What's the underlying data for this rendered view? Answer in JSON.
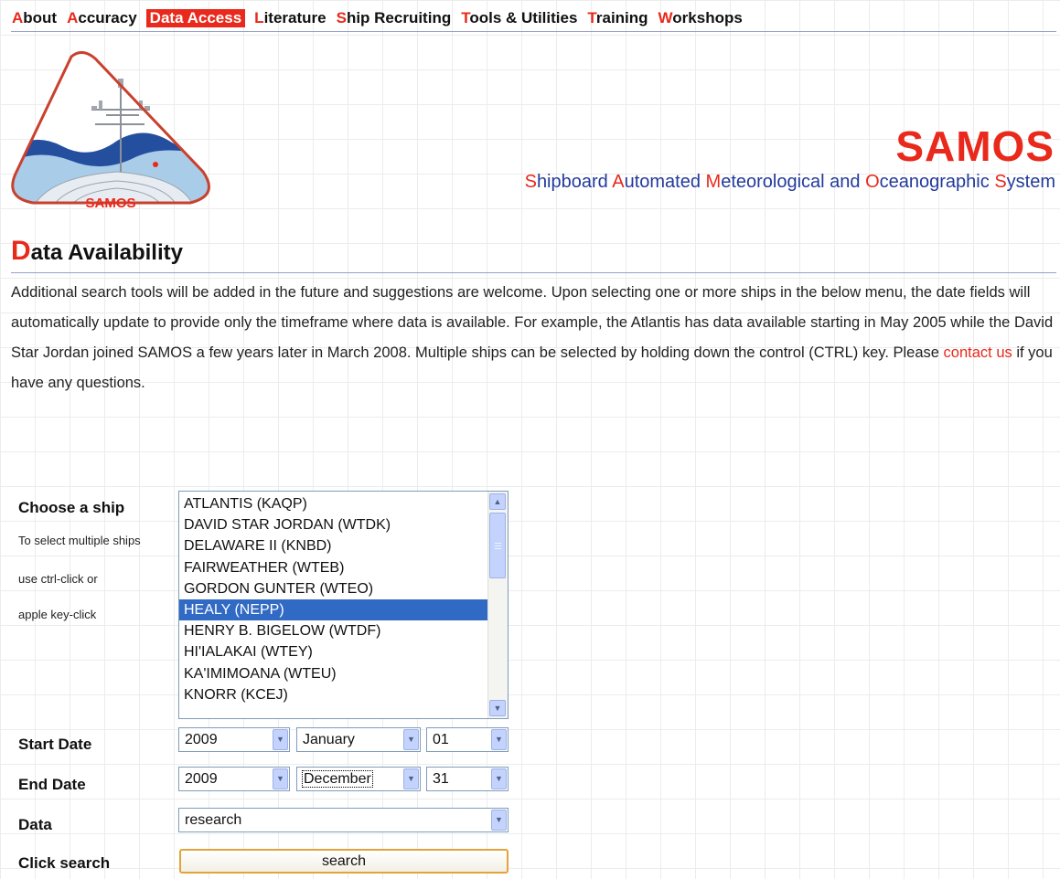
{
  "nav": {
    "items": [
      {
        "first": "A",
        "rest": "bout"
      },
      {
        "first": "A",
        "rest": "ccuracy"
      },
      {
        "first": "D",
        "rest": "ata Access"
      },
      {
        "first": "L",
        "rest": "iterature"
      },
      {
        "first": "S",
        "rest": "hip Recruiting"
      },
      {
        "first": "T",
        "rest": "ools & Utilities"
      },
      {
        "first": "T",
        "rest": "raining"
      },
      {
        "first": "W",
        "rest": "orkshops"
      }
    ],
    "active_index": 2
  },
  "logo": {
    "text": "SAMOS"
  },
  "brand": {
    "title": "SAMOS",
    "subtitle_parts": [
      {
        "cap": "S",
        "rest": "hipboard "
      },
      {
        "cap": "A",
        "rest": "utomated "
      },
      {
        "cap": "M",
        "rest": "eteorological and "
      },
      {
        "cap": "O",
        "rest": "ceanographic "
      },
      {
        "cap": "S",
        "rest": "ystem"
      }
    ]
  },
  "heading": {
    "first": "D",
    "rest": "ata Availability"
  },
  "intro": {
    "text_before": "Additional search tools will be added in the future and suggestions are welcome. Upon selecting one or more ships in the below menu, the date fields will automatically update to provide only the timeframe where data is available. For example, the Atlantis has data available starting in May 2005 while the David Star Jordan joined SAMOS a few years later in March 2008. Multiple ships can be selected by holding down the control (CTRL) key. Please ",
    "link": "contact us",
    "text_after": " if you have any questions."
  },
  "form": {
    "choose_label": "Choose a ship",
    "hint_lines": [
      "To select multiple ships",
      "use ctrl-click or",
      "apple key-click"
    ],
    "ships": [
      "ATLANTIS (KAQP)",
      "DAVID STAR JORDAN (WTDK)",
      "DELAWARE II (KNBD)",
      "FAIRWEATHER (WTEB)",
      "GORDON GUNTER (WTEO)",
      "HEALY (NEPP)",
      "HENRY B. BIGELOW (WTDF)",
      "HI'IALAKAI (WTEY)",
      "KA'IMIMOANA (WTEU)",
      "KNORR (KCEJ)"
    ],
    "selected_ship_index": 5,
    "start_label": "Start Date",
    "start": {
      "year": "2009",
      "month": "January",
      "day": "01"
    },
    "end_label": "End Date",
    "end": {
      "year": "2009",
      "month": "December",
      "day": "31"
    },
    "data_label": "Data",
    "data_value": "research",
    "search_label": "Click search",
    "search_button": "search"
  },
  "icons": {
    "scroll_up": "scroll-up-icon",
    "scroll_down": "scroll-down-icon",
    "dropdown": "chevron-down-icon"
  },
  "colors": {
    "accent": "#e8291b",
    "brand_blue": "#223a9b",
    "selection": "#316ac5"
  }
}
